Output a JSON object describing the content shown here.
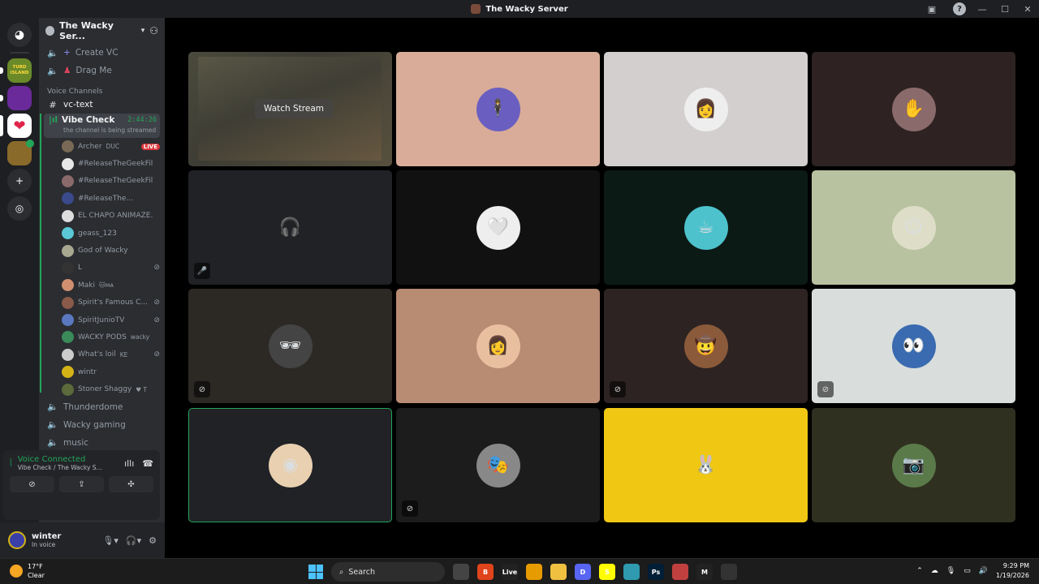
{
  "window": {
    "title": "The Wacky Server"
  },
  "guilds": [
    {
      "name": "home",
      "icon": "discord-icon"
    },
    {
      "name": "turd-island",
      "label": "TURD ISLAND"
    },
    {
      "name": "server-2"
    },
    {
      "name": "wacky-server",
      "active": true
    },
    {
      "name": "server-4"
    }
  ],
  "server": {
    "name": "The Wacky Ser...",
    "invite_icon": "add-member-icon"
  },
  "channels_top": [
    {
      "label": "Create VC",
      "prefix": "+"
    },
    {
      "label": "Drag Me",
      "prefix": "♟"
    }
  ],
  "category": {
    "label": "Voice Channels"
  },
  "text_channel": {
    "label": "vc-text"
  },
  "active_vc": {
    "label": "Vibe Check",
    "timer": "2:44:26",
    "subtitle": "the channel is being streamed"
  },
  "members": [
    {
      "name": "Archer",
      "extra": "DUC",
      "live": "LIVE",
      "color": "#7a6a55"
    },
    {
      "name": "#ReleaseTheGeekFiles",
      "color": "#e8e8e8"
    },
    {
      "name": "#ReleaseTheGeekFiles",
      "color": "#8a6a6a"
    },
    {
      "name": "#ReleaseThe...",
      "color": "#3a4a8a"
    },
    {
      "name": "EL CHAPO ANIMAZE...",
      "color": "#ddd"
    },
    {
      "name": "geass_123",
      "color": "#5ac8d6"
    },
    {
      "name": "God of Wacky",
      "color": "#a8a890"
    },
    {
      "name": "L",
      "color": "#333",
      "deaf": true
    },
    {
      "name": "Maki",
      "extra": "🐱ᴍᴀ",
      "color": "#d09070"
    },
    {
      "name": "Spirit's Famous C...",
      "color": "#8a5a4a",
      "deaf": true
    },
    {
      "name": "SpiritJunioTV",
      "color": "#5a78c0",
      "deaf": true
    },
    {
      "name": "WACKY PODS",
      "extra": "wacky",
      "color": "#3a8a5a"
    },
    {
      "name": "What's loil",
      "extra": "KE",
      "color": "#ccc",
      "deaf": true
    },
    {
      "name": "wintr",
      "color": "#d4b316"
    },
    {
      "name": "Stoner Shaggy",
      "extra": "♥ T",
      "color": "#5a6a3a"
    }
  ],
  "channels_bottom": [
    {
      "label": "Thunderdome"
    },
    {
      "label": "Wacky gaming"
    },
    {
      "label": "music"
    }
  ],
  "voice_panel": {
    "status": "Voice Connected",
    "location": "Vibe Check / The Wacky S..."
  },
  "user": {
    "name": "winter",
    "status": "In voice"
  },
  "stream": {
    "watch_label": "Watch Stream"
  },
  "tiles": [
    {
      "bg": "#d8ac98",
      "av": "#6a5fc0",
      "glyph": "🕴"
    },
    {
      "bg": "#d3cfcf",
      "av": "#eee",
      "glyph": "👩"
    },
    {
      "bg": "#2e2222",
      "av": "#8a6a6a",
      "glyph": "✋"
    },
    {
      "bg": "#202226",
      "av": "transparent",
      "glyph": "🎧",
      "muted": "🎤"
    },
    {
      "bg": "#111111",
      "av": "#eee",
      "glyph": "🤍"
    },
    {
      "bg": "#0c1a16",
      "av": "#4ec2cc",
      "glyph": "☕"
    },
    {
      "bg": "#b8c2a0",
      "av": "#dedec8",
      "glyph": "☺"
    },
    {
      "bg": "#2c2925",
      "av": "#444",
      "glyph": "🕶",
      "muted": "⊘"
    },
    {
      "bg": "#b88b73",
      "av": "#e8c0a0",
      "glyph": "👩"
    },
    {
      "bg": "#2d2322",
      "av": "#8a5a3a",
      "glyph": "🤠",
      "muted": "⊘"
    },
    {
      "bg": "#d9dedc",
      "av": "#3a6ab0",
      "glyph": "👀",
      "muted": "⊘"
    },
    {
      "bg": "#202226",
      "av": "#e8d0b0",
      "glyph": "◉",
      "speaking": true
    },
    {
      "bg": "#1c1c1c",
      "av": "#888",
      "glyph": "🎭",
      "muted": "⊘"
    },
    {
      "bg": "#f0c814",
      "av": "transparent",
      "glyph": "🐰"
    },
    {
      "bg": "#303020",
      "av": "#5a7a4a",
      "glyph": "📷"
    }
  ],
  "taskbar": {
    "temp": "17°F",
    "cond": "Clear",
    "search": "Search",
    "time": "9:29 PM",
    "date": "1/19/2026",
    "apps": [
      {
        "label": "",
        "color": "#444"
      },
      {
        "label": "B",
        "color": "#e0441c"
      },
      {
        "label": "Live",
        "color": "#222"
      },
      {
        "label": "",
        "color": "#e69b00"
      },
      {
        "label": "",
        "color": "#f0c040"
      },
      {
        "label": "D",
        "color": "#5865f2"
      },
      {
        "label": "S",
        "color": "#fffc00"
      },
      {
        "label": "",
        "color": "#2f9ab0"
      },
      {
        "label": "Ps",
        "color": "#001e36"
      },
      {
        "label": "",
        "color": "#c04040"
      },
      {
        "label": "M",
        "color": "#222"
      },
      {
        "label": "",
        "color": "#333"
      }
    ]
  }
}
